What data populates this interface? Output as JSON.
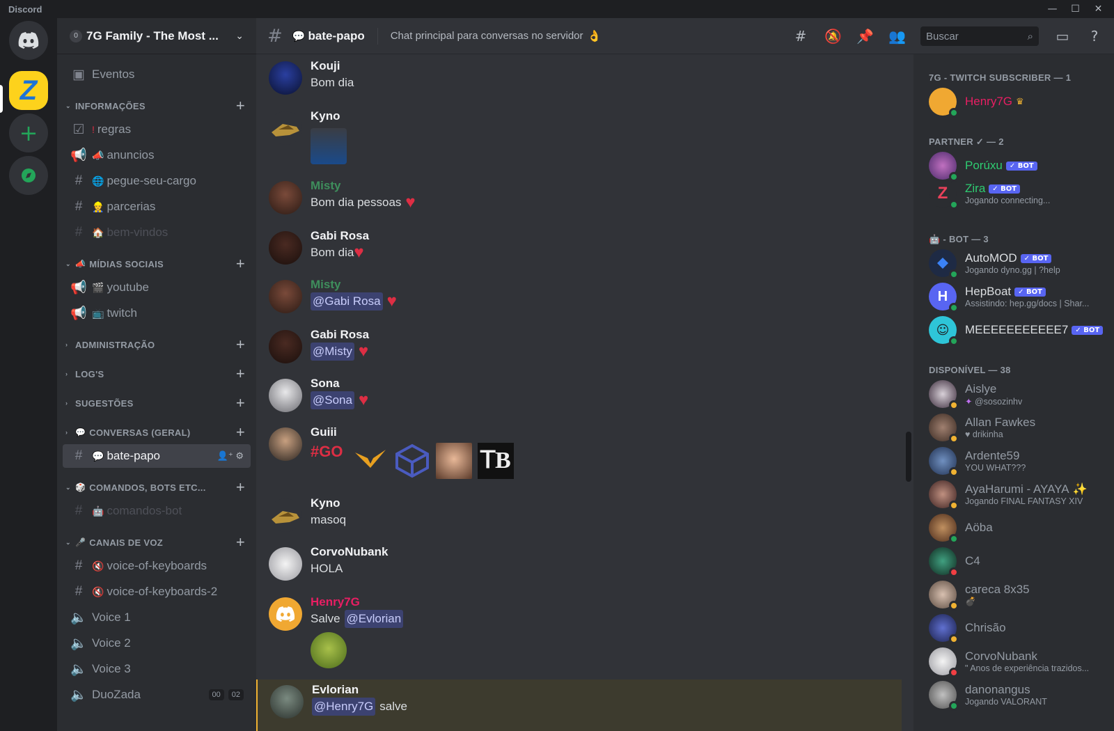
{
  "window": {
    "app_name": "Discord",
    "controls": [
      "—",
      "☐",
      "✕"
    ]
  },
  "rail": {
    "server_initials": "Z"
  },
  "guild": {
    "boost_count": "0",
    "name": "7G Family - The Most ..."
  },
  "channel_list": {
    "events_label": "Eventos",
    "categories": {
      "info": "INFORMAÇÕES",
      "midias": "MÍDIAS SOCIAIS",
      "admin": "ADMINISTRAÇÃO",
      "logs": "LOG'S",
      "sugestoes": "SUGESTÕES",
      "conversas": "CONVERSAS (GERAL)",
      "comandos": "COMANDOS, BOTS ETC...",
      "voz": "CANAIS DE VOZ"
    },
    "channels": {
      "regras": "regras",
      "anuncios": "anuncios",
      "pegue": "pegue-seu-cargo",
      "parcerias": "parcerias",
      "bemvindos": "bem-vindos",
      "youtube": "youtube",
      "twitch": "twitch",
      "batepapo": "bate-papo",
      "comandosbot": "comandos-bot",
      "vok": "voice-of-keyboards",
      "vok2": "voice-of-keyboards-2",
      "voice1": "Voice 1",
      "voice2": "Voice 2",
      "voice3": "Voice 3",
      "duozada": "DuoZada"
    },
    "duozada_badges": [
      "00",
      "02"
    ]
  },
  "topbar": {
    "channel_name": "bate-papo",
    "topic": "Chat principal para conversas no servidor",
    "search_placeholder": "Buscar"
  },
  "messages": [
    {
      "author": "Kouji",
      "text": "Bom dia"
    },
    {
      "author": "Kyno",
      "text": ""
    },
    {
      "author": "Misty",
      "text": "Bom dia pessoas"
    },
    {
      "author": "Gabi Rosa",
      "text": "Bom dia"
    },
    {
      "author": "Misty",
      "mention": "@Gabi Rosa"
    },
    {
      "author": "Gabi Rosa",
      "mention": "@Misty"
    },
    {
      "author": "Sona",
      "mention": "@Sona"
    },
    {
      "author": "Guiii",
      "emote_text": "#GO"
    },
    {
      "author": "Kyno",
      "text": "masoq"
    },
    {
      "author": "CorvoNubank",
      "text": "HOLA"
    },
    {
      "author": "Henry7G",
      "text": "Salve",
      "mention": "@Evlorian"
    },
    {
      "author": "Evlorian",
      "mention": "@Henry7G",
      "text": "salve"
    }
  ],
  "members": {
    "groups": {
      "twitch": "7G - TWITCH SUBSCRIBER — 1",
      "partner": "PARTNER ✓ — 2",
      "bot": "- BOT — 3",
      "disponivel": "DISPONÍVEL — 38"
    },
    "bot_badge": "✓ BOT",
    "list": [
      {
        "name": "Henry7G",
        "sub": ""
      },
      {
        "name": "Porúxu",
        "sub": ""
      },
      {
        "name": "Zira",
        "sub": "Jogando connecting..."
      },
      {
        "name": "AutoMOD",
        "sub": "Jogando dyno.gg | ?help"
      },
      {
        "name": "HepBoat",
        "sub": "Assistindo: hep.gg/docs | Shar..."
      },
      {
        "name": "MEEEEEEEEEEE7",
        "sub": ""
      },
      {
        "name": "Aislye",
        "sub": "@sosozinhv"
      },
      {
        "name": "Allan Fawkes",
        "sub": "drikinha"
      },
      {
        "name": "Ardente59",
        "sub": "YOU WHAT???"
      },
      {
        "name": "AyaHarumi - AYAYA",
        "sub": "Jogando FINAL FANTASY XIV"
      },
      {
        "name": "Aöba",
        "sub": ""
      },
      {
        "name": "C4",
        "sub": ""
      },
      {
        "name": "careca 8x35",
        "sub": ""
      },
      {
        "name": "Chrisão",
        "sub": ""
      },
      {
        "name": "CorvoNubank",
        "sub": "\" Anos de experiência trazidos..."
      },
      {
        "name": "danonangus",
        "sub": "Jogando VALORANT"
      }
    ]
  },
  "colors": {
    "henry": "#e91e63",
    "misty": "#3e8e5c",
    "partner": "#2ecc71",
    "online": "#23a559",
    "idle": "#f0b232",
    "dnd": "#f23f43"
  }
}
